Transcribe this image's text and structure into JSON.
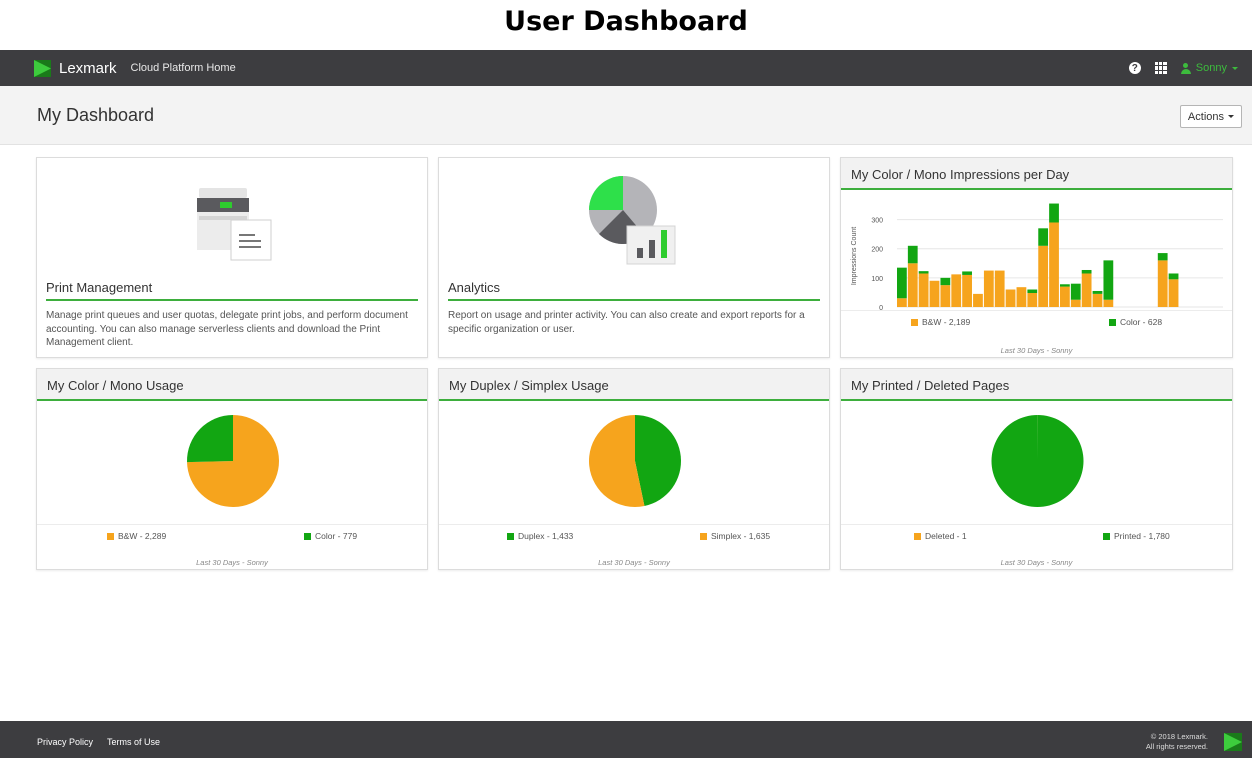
{
  "page_heading": "User Dashboard",
  "topbar": {
    "brand": "Lexmark",
    "subtitle": "Cloud Platform Home",
    "help_icon": "question-circle-icon",
    "apps_icon": "grid-icon",
    "user_icon": "user-icon",
    "user_name": "Sonny"
  },
  "subheader": {
    "title": "My Dashboard",
    "actions_label": "Actions"
  },
  "tiles": {
    "print_management": {
      "title": "Print Management",
      "description": "Manage print queues and user quotas, delegate print jobs, and perform document accounting. You can also manage serverless clients and download the Print Management client.",
      "icon": "printer-icon"
    },
    "analytics": {
      "title": "Analytics",
      "description": "Report on usage and printer activity. You can also create and export reports for a specific organization or user.",
      "icon": "pie-chart-icon"
    }
  },
  "colors": {
    "accent_green": "#3dae3d",
    "series_green": "#12a612",
    "series_orange": "#f6a41d",
    "topbar": "#3d3d40"
  },
  "chart_data": [
    {
      "type": "bar",
      "title": "My Color / Mono Impressions per Day",
      "ylabel": "Impressions Count",
      "ylim": [
        0,
        350
      ],
      "yticks": [
        0,
        100,
        200,
        300
      ],
      "stacked": true,
      "x": [
        1,
        2,
        3,
        4,
        5,
        6,
        7,
        8,
        9,
        10,
        11,
        12,
        13,
        14,
        15,
        16,
        17,
        18,
        19,
        20,
        21,
        22,
        23,
        24,
        25,
        26,
        27,
        28,
        29,
        30
      ],
      "series": [
        {
          "name": "B&W - 2,189",
          "color": "#f6a41d",
          "values": [
            30,
            150,
            115,
            90,
            75,
            112,
            110,
            45,
            125,
            125,
            60,
            68,
            48,
            210,
            290,
            70,
            25,
            115,
            45,
            25,
            0,
            0,
            0,
            0,
            160,
            95,
            0,
            0,
            0,
            0
          ]
        },
        {
          "name": "Color - 628",
          "color": "#12a612",
          "values": [
            105,
            60,
            8,
            0,
            25,
            0,
            12,
            0,
            0,
            0,
            0,
            0,
            12,
            60,
            65,
            8,
            55,
            12,
            10,
            135,
            0,
            0,
            0,
            0,
            25,
            20,
            0,
            0,
            0,
            0
          ]
        }
      ],
      "grid": true,
      "footnote": "Last 30 Days - Sonny"
    },
    {
      "type": "pie",
      "title": "My Color / Mono Usage",
      "slices": [
        {
          "label": "B&W - 2,289",
          "value": 2289,
          "color": "#f6a41d"
        },
        {
          "label": "Color - 779",
          "value": 779,
          "color": "#12a612"
        }
      ],
      "footnote": "Last 30 Days - Sonny"
    },
    {
      "type": "pie",
      "title": "My Duplex / Simplex Usage",
      "slices": [
        {
          "label": "Duplex - 1,433",
          "value": 1433,
          "color": "#12a612"
        },
        {
          "label": "Simplex - 1,635",
          "value": 1635,
          "color": "#f6a41d"
        }
      ],
      "footnote": "Last 30 Days - Sonny"
    },
    {
      "type": "pie",
      "title": "My Printed / Deleted Pages",
      "slices": [
        {
          "label": "Deleted - 1",
          "value": 1,
          "color": "#f6a41d"
        },
        {
          "label": "Printed - 1,780",
          "value": 1780,
          "color": "#12a612"
        }
      ],
      "footnote": "Last 30 Days - Sonny"
    }
  ],
  "footer": {
    "links": [
      "Privacy Policy",
      "Terms of Use"
    ],
    "copyright_line1": "© 2018 Lexmark.",
    "copyright_line2": "All rights reserved."
  }
}
